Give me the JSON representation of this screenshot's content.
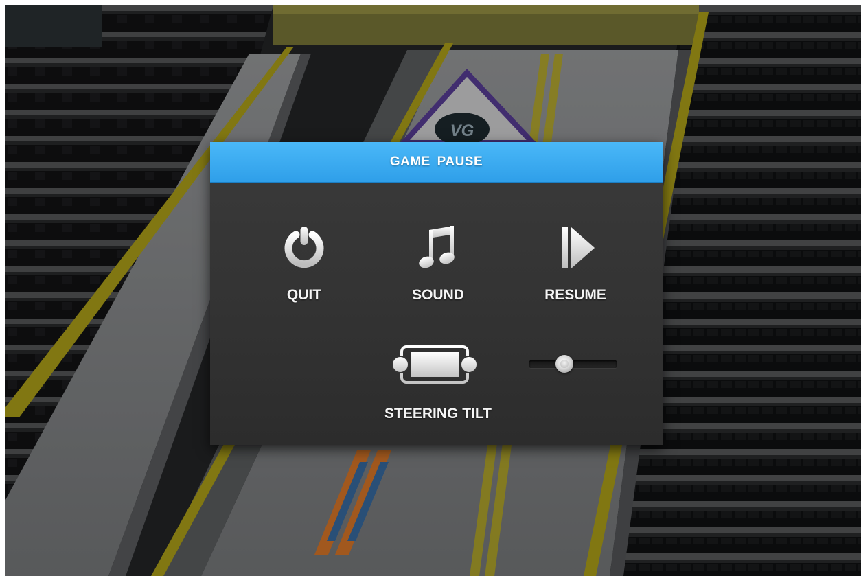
{
  "dialog": {
    "title": "GAME  PAUSE"
  },
  "buttons": {
    "quit": {
      "label": "QUIT",
      "icon": "power-icon"
    },
    "sound": {
      "label": "SOUND",
      "icon": "music-note-icon"
    },
    "resume": {
      "label": "RESUME",
      "icon": "play-icon"
    },
    "steering": {
      "label": "STEERING TILT",
      "icon": "tilt-device-icon"
    }
  },
  "tilt_slider": {
    "level": 0.4
  },
  "background": {
    "logo_text": "VG"
  },
  "colors": {
    "header": "#39a9f0",
    "panel": "#333333",
    "label": "#f4f4f4",
    "rail_yellow": "#b3a51a",
    "ramp": "#8a8c8e"
  }
}
